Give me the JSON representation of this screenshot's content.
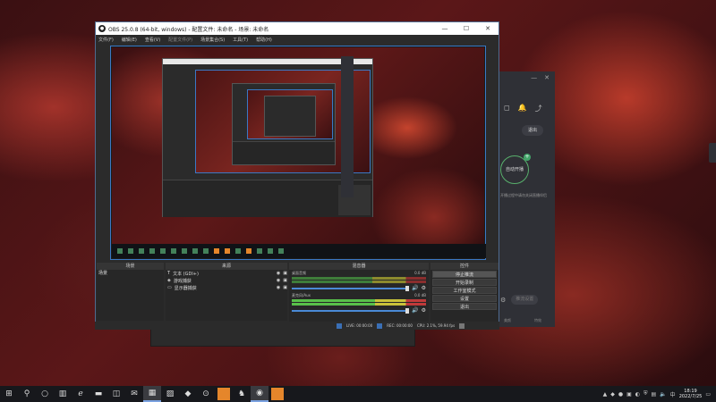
{
  "obs": {
    "title": "OBS 25.0.8 (64-bit, windows) - 配置文件: 未命名 - 场景: 未命名",
    "menu": [
      "文件(F)",
      "编辑(E)",
      "查看(V)",
      "配置文件(P)",
      "场景集合(S)",
      "工具(T)",
      "帮助(H)"
    ],
    "scenes_title": "场景",
    "scene_item": "场景",
    "sources_title": "来源",
    "sources": [
      "文本 (GDI+)",
      "游戏捕获",
      "显示器捕获"
    ],
    "mixer_title": "混音器",
    "channels": [
      {
        "name": "桌面音频",
        "db": "0.0 dB"
      },
      {
        "name": "麦克风/Aux",
        "db": "0.0 dB"
      }
    ],
    "controls_title": "控件",
    "controls": [
      "停止推流",
      "开始录制",
      "工作室模式",
      "设置",
      "退出"
    ],
    "status": {
      "live": "LIVE: 00:00:00",
      "rec": "REC: 00:00:00",
      "cpu": "CPU: 2.1%, 59.94 fps"
    }
  },
  "live_panel": {
    "exit": "退出",
    "auto_stream": "自动开播",
    "desc": "开播过程中请勿关闭直播伴侣",
    "push": "推流设置",
    "footer": [
      "美颜",
      "特效"
    ]
  },
  "taskbar": {
    "time": "18:19",
    "date": "2022/7/25"
  }
}
